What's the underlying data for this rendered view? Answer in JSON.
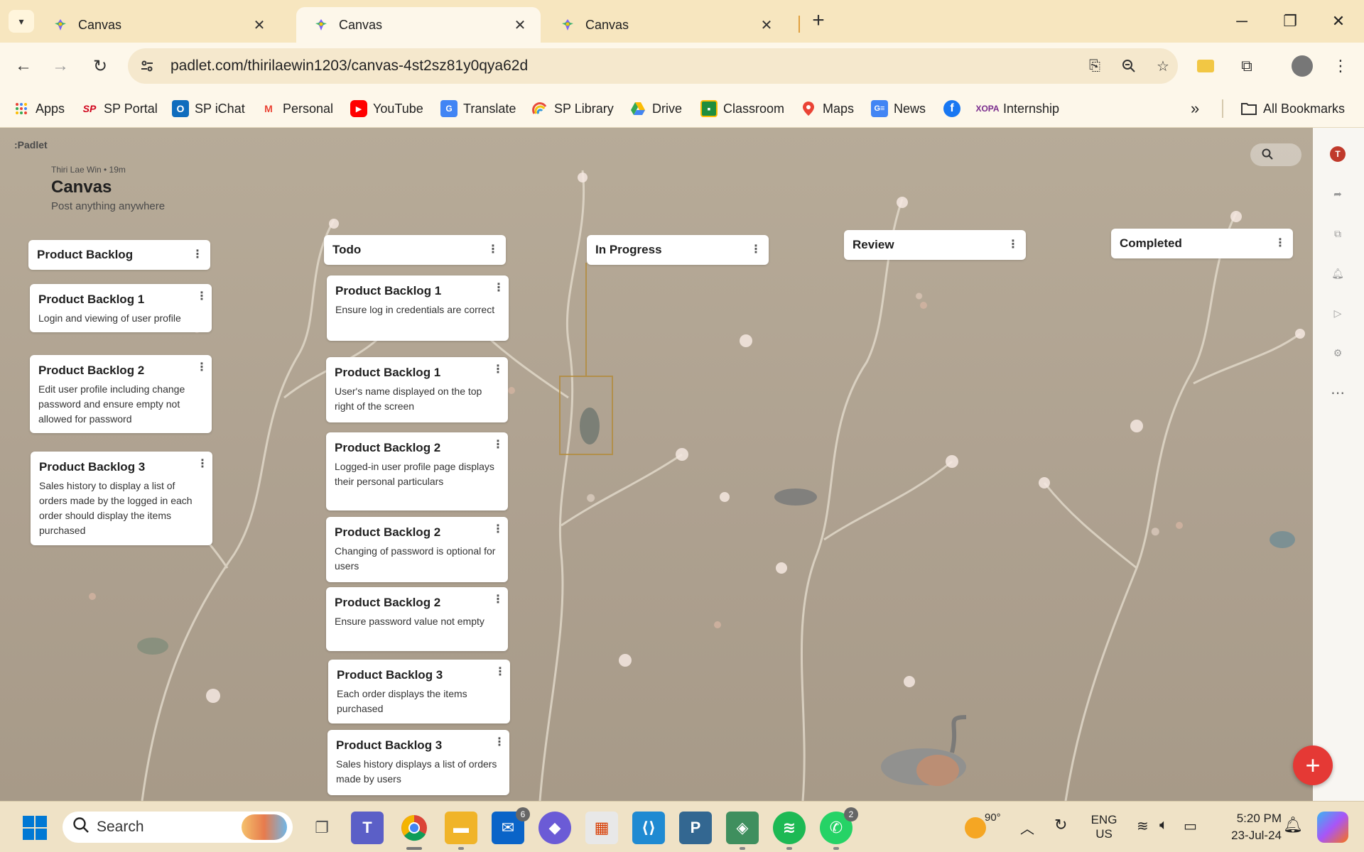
{
  "browser": {
    "tabs": [
      {
        "title": "Canvas",
        "active": false
      },
      {
        "title": "Canvas",
        "active": true
      },
      {
        "title": "Canvas",
        "active": false
      }
    ],
    "url": "padlet.com/thirilaewin1203/canvas-4st2sz81y0qya62d"
  },
  "bookmarks": [
    {
      "label": "Apps",
      "icon": "apps-grid-icon"
    },
    {
      "label": "SP Portal",
      "icon": "sp-icon"
    },
    {
      "label": "SP iChat",
      "icon": "outlook-icon"
    },
    {
      "label": "Personal",
      "icon": "gmail-icon"
    },
    {
      "label": "YouTube",
      "icon": "youtube-icon"
    },
    {
      "label": "Translate",
      "icon": "translate-icon"
    },
    {
      "label": "SP Library",
      "icon": "rainbow-icon"
    },
    {
      "label": "Drive",
      "icon": "drive-icon"
    },
    {
      "label": "Classroom",
      "icon": "classroom-icon"
    },
    {
      "label": "Maps",
      "icon": "maps-icon"
    },
    {
      "label": "News",
      "icon": "news-icon"
    },
    {
      "label": "",
      "icon": "facebook-icon"
    },
    {
      "label": "Internship",
      "icon": "xopa-icon"
    }
  ],
  "bookmarks_overflow": "»",
  "all_bookmarks": "All Bookmarks",
  "padlet": {
    "logo": ":Padlet",
    "author_meta": "Thiri Lae Win • 19m",
    "title": "Canvas",
    "subtitle": "Post anything anywhere",
    "avatar_letter": "T",
    "columns": [
      {
        "title": "Product Backlog",
        "cards": [
          {
            "title": "Product Backlog 1",
            "body": "Login and viewing of user profile"
          },
          {
            "title": "Product Backlog 2",
            "body": "Edit user profile including change password and ensure empty not allowed for password"
          },
          {
            "title": "Product Backlog 3",
            "body": "Sales history to display a list of orders made by the logged in each order should display the items purchased"
          }
        ]
      },
      {
        "title": "Todo",
        "cards": [
          {
            "title": "Product Backlog 1",
            "body": "Ensure log in credentials are correct"
          },
          {
            "title": "Product Backlog 1",
            "body": "User's name displayed on the top right of the screen"
          },
          {
            "title": "Product Backlog 2",
            "body": "Logged-in user profile page displays their personal particulars"
          },
          {
            "title": "Product Backlog 2",
            "body": "Changing of password is optional for users"
          },
          {
            "title": "Product Backlog 2",
            "body": "Ensure password value not empty"
          },
          {
            "title": "Product Backlog 3",
            "body": "Each order displays the items purchased"
          },
          {
            "title": "Product Backlog 3",
            "body": "Sales history displays a list of orders made by users"
          }
        ]
      },
      {
        "title": "In Progress",
        "cards": []
      },
      {
        "title": "Review",
        "cards": []
      },
      {
        "title": "Completed",
        "cards": []
      }
    ]
  },
  "taskbar": {
    "search_placeholder": "Search",
    "mail_badge": "6",
    "whatsapp_badge": "2",
    "weather": "90°",
    "lang_1": "ENG",
    "lang_2": "US",
    "time": "5:20 PM",
    "date": "23-Jul-24"
  },
  "colors": {
    "fab": "#e53935",
    "avatar": "#c0392b",
    "tabbar": "#f7e6bf"
  }
}
